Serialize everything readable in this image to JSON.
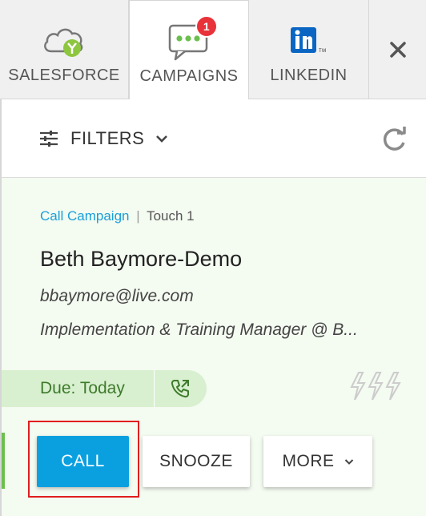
{
  "tabs": {
    "salesforce_label": "SALESFORCE",
    "campaigns_label": "CAMPAIGNS",
    "campaigns_badge": "1",
    "linkedin_label": "LINKEDIN",
    "close_glyph": "✕"
  },
  "filters": {
    "label": "FILTERS"
  },
  "card": {
    "campaign_link": "Call Campaign",
    "separator": "|",
    "touch": "Touch 1",
    "name": "Beth Baymore-Demo",
    "email": "bbaymore@live.com",
    "title": "Implementation & Training Manager @ B..."
  },
  "due": {
    "label": "Due: Today"
  },
  "actions": {
    "call_label": "CALL",
    "snooze_label": "SNOOZE",
    "more_label": "MORE"
  },
  "colors": {
    "accent_blue": "#0aa0e0",
    "link_blue": "#1a9fd9",
    "due_green_bg": "#d8f0cf",
    "due_green_text": "#3e7a2c",
    "badge_red": "#e8333a",
    "highlight_red": "#e01e1e",
    "card_bg": "#f4fbf1"
  },
  "icons": {
    "salesforce": "cloud-y-icon",
    "campaigns": "chat-dots-icon",
    "linkedin": "linkedin-icon",
    "close": "close-icon",
    "filters": "sliders-icon",
    "refresh": "refresh-icon",
    "phone": "phone-outgoing-icon",
    "bolts": "lightning-bolts-icon",
    "more_chevron": "chevron-down-icon"
  }
}
